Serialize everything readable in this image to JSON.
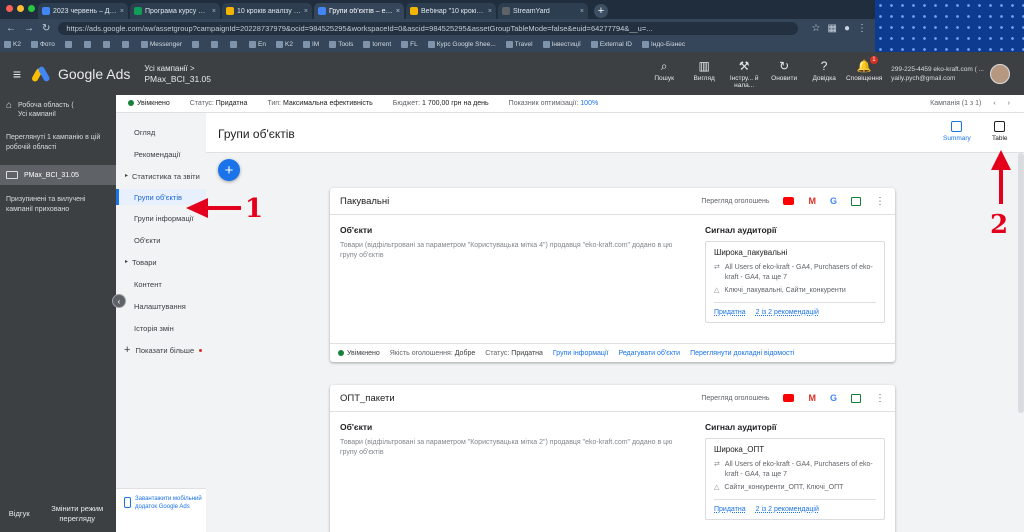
{
  "browser": {
    "tabs": [
      {
        "label": "2023 червень – Дайджест – Goo",
        "color": "#4285f4"
      },
      {
        "label": "Програма курсу – Google Ш",
        "color": "#0f9d58"
      },
      {
        "label": "10 кроків аналізу ефективнос",
        "color": "#f4b400"
      },
      {
        "label": "Групи об'єктів – eko-kraft.com",
        "color": "#4285f4"
      },
      {
        "label": "Вебінар \"10 кроків аналізу еф",
        "color": "#f4b400"
      },
      {
        "label": "StreamYard",
        "color": "#5f6368"
      }
    ],
    "url": "https://ads.google.com/aw/assetgroup?campaignId=20228737979&ocid=984525295&workspaceId=0&ascid=984525295&assetGroupTableMode=false&euid=64277794&__u=...",
    "bookmarks": [
      "K2",
      "Фото",
      "",
      "",
      "",
      "",
      "Messenger",
      "",
      "",
      "",
      "En",
      "K2",
      "IM",
      "Tools",
      "torrent",
      "FL",
      "Курс Google Shee...",
      "Travel",
      "Інвестиції",
      "External ID",
      "Індо-Бізнес"
    ]
  },
  "header": {
    "brand": "Google Ads",
    "account_path": "Усі кампанії  >",
    "account_name": "PMax_BCI_31.05",
    "tools": [
      {
        "icon": "search-icon",
        "glyph": "⌕",
        "label": "Пошук"
      },
      {
        "icon": "chart-icon",
        "glyph": "▥",
        "label": "Вигляд"
      },
      {
        "icon": "wrench-icon",
        "glyph": "⚒",
        "label": "Інстру... й нала..."
      },
      {
        "icon": "refresh-icon",
        "glyph": "↻",
        "label": "Оновити"
      },
      {
        "icon": "help-icon",
        "glyph": "?",
        "label": "Довідка"
      },
      {
        "icon": "bell-icon",
        "glyph": "🔔",
        "label": "Сповіщення",
        "badge": "1"
      }
    ],
    "user_account": "299-225-4459 eko-kraft.com ( ...",
    "user_email": "yaily.pych@gmail.com"
  },
  "rail": {
    "workspace_label": "Робоча область (",
    "workspace_value": "Усі кампанії",
    "info": "Переглянуті 1 кампанію в цій робочій області",
    "campaign": "PMax_BCI_31.05",
    "note": "Призупинені та вилучені кампанії приховано",
    "feedback": "Відгук",
    "change_mode": "Змінити режим перегляду"
  },
  "status": {
    "state": "Увімкнено",
    "status_label": "Статус:",
    "status_value": "Придатна",
    "type_label": "Тип:",
    "type_value": "Максимальна ефективність",
    "budget_label": "Бюджет:",
    "budget_value": "1 700,00 грн на день",
    "opt_label": "Показник оптимізації:",
    "opt_value": "100%",
    "campaigns_count": "Кампанія (1 з 1)"
  },
  "nav": {
    "items": [
      {
        "label": "Огляд"
      },
      {
        "label": "Рекомендації"
      },
      {
        "label": "Статистика та звіти",
        "caret": true
      },
      {
        "label": "Групи об'єктів",
        "selected": true
      },
      {
        "label": "Групи інформації"
      },
      {
        "label": "Об'єкти"
      },
      {
        "label": "Товари",
        "caret": true
      },
      {
        "label": "Контент"
      },
      {
        "label": "Налаштування"
      },
      {
        "label": "Історія змін"
      }
    ],
    "more": "Показати більше",
    "app_promo": "Завантажити мобільний додаток Google Ads"
  },
  "page": {
    "title": "Групи об'єктів",
    "summary_label": "Summary",
    "table_label": "Table",
    "add_label": "+"
  },
  "cards": [
    {
      "title": "Пакувальні",
      "preview": "Перегляд оголошень",
      "assets_heading": "Об'єкти",
      "assets_text": "Товари (відфільтровані за параметром \"Користувацька мітка 4\") продавця \"eko-kraft.com\" додано в цю групу об'єктів",
      "audience_heading": "Сигнал аудиторії",
      "signal_name": "Широка_пакувальні",
      "signal_lists": "All Users of eko-kraft - GA4, Purchasers of eko-kraft - GA4, та ще 7",
      "signal_keywords": "Ключі_пакувальні, Сайти_конкуренти",
      "signal_status": "Придатна",
      "signal_recs": "2 із 2 рекомендацій",
      "footer": {
        "state": "Увімкнено",
        "quality_label": "Якість оголошення:",
        "quality_value": "Добре",
        "status_label": "Статус:",
        "status_value": "Придатна",
        "link1": "Групи інформації",
        "link2": "Редагувати об'єкти",
        "link3": "Переглянути докладні відомості"
      }
    },
    {
      "title": "ОПТ_пакети",
      "preview": "Перегляд оголошень",
      "assets_heading": "Об'єкти",
      "assets_text": "Товари (відфільтровані за параметром \"Користувацька мітка 2\") продавця \"eko-kraft.com\" додано в цю групу об'єктів",
      "audience_heading": "Сигнал аудиторії",
      "signal_name": "Широка_ОПТ",
      "signal_lists": "All Users of eko-kraft - GA4, Purchasers of eko-kraft - GA4, та ще 7",
      "signal_keywords": "Сайти_конкуренти_ОПТ, Ключі_ОПТ",
      "signal_status": "Придатна",
      "signal_recs": "2 із 2 рекомендацій"
    }
  ],
  "annotations": {
    "arrow1_number": "1",
    "arrow2_number": "2",
    "color": "#e4001c"
  }
}
